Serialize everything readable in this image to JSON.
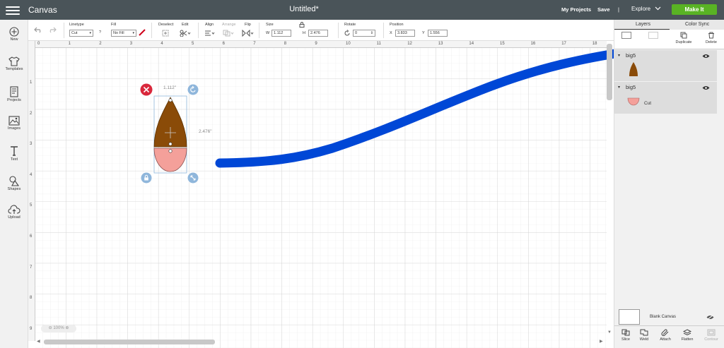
{
  "topbar": {
    "app_title": "Canvas",
    "doc_title": "Untitled*",
    "my_projects": "My Projects",
    "save": "Save",
    "divider": "|",
    "explore": "Explore",
    "make_it": "Make It",
    "make_it_color": "#59b324"
  },
  "toolbar": {
    "linetype_label": "Linetype",
    "linetype_value": "Cut",
    "help": "?",
    "fill_label": "Fill",
    "fill_value": "No Fill",
    "deselect_label": "Deselect",
    "edit_label": "Edit",
    "align_label": "Align",
    "arrange_label": "Arrange",
    "flip_label": "Flip",
    "size_label": "Size",
    "w_label": "W",
    "w_value": "1.112",
    "h_label": "H",
    "h_value": "2.476",
    "rotate_label": "Rotate",
    "rotate_value": "0",
    "position_label": "Position",
    "x_label": "X",
    "x_value": "3.833",
    "y_label": "Y",
    "y_value": "1.556"
  },
  "sidebar": {
    "items": [
      {
        "label": "New",
        "icon": "plus-circle-icon"
      },
      {
        "label": "Templates",
        "icon": "shirt-icon"
      },
      {
        "label": "Projects",
        "icon": "projects-icon"
      },
      {
        "label": "Images",
        "icon": "image-icon"
      },
      {
        "label": "Text",
        "icon": "text-icon"
      },
      {
        "label": "Shapes",
        "icon": "shapes-icon"
      },
      {
        "label": "Upload",
        "icon": "upload-cloud-icon"
      }
    ]
  },
  "canvas": {
    "ruler_top": [
      "0",
      "1",
      "2",
      "3",
      "4",
      "5",
      "6",
      "7",
      "8",
      "9",
      "10",
      "11",
      "12",
      "13",
      "14",
      "15",
      "16",
      "17",
      "18"
    ],
    "ruler_left": [
      "1",
      "2",
      "3",
      "4",
      "5",
      "6",
      "7",
      "8",
      "9"
    ],
    "width_label": "1.112\"",
    "height_label": "2.476\"",
    "zoom": "100%",
    "shape_top_color": "#8a4b08",
    "shape_bottom_color": "#f4a09a",
    "arrow_color": "#0047d6"
  },
  "right_panel": {
    "tab_layers": "Layers",
    "tab_color_sync": "Color Sync",
    "duplicate": "Duplicate",
    "delete": "Delete",
    "layers": [
      {
        "group": "big5",
        "child_label": ""
      },
      {
        "group": "big5",
        "child_label": "Cut"
      }
    ],
    "blank_canvas": "Blank Canvas",
    "bottom_tools": [
      "Slice",
      "Weld",
      "Attach",
      "Flatten",
      "Contour"
    ]
  }
}
